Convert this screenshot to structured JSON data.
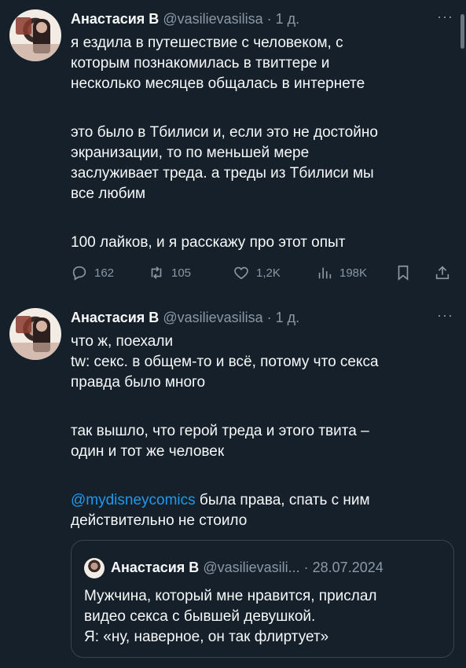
{
  "tweets": [
    {
      "name": "Анастасия В",
      "handle": "@vasilievasilisa",
      "time": "· 1 д.",
      "more": "···",
      "lines": [
        "я ездила в путешествие с человеком, с",
        "которым познакомилась в твиттере и",
        "несколько месяцев общалась в интернете",
        "",
        "это было в Тбилиси и, если это не достойно",
        "экранизации, то по меньшей мере",
        "заслуживает треда. а треды из Тбилиси мы",
        "все любим",
        "",
        "100 лайков, и я расскажу про этот опыт"
      ],
      "actions": {
        "replies": "162",
        "reposts": "105",
        "likes": "1,2K",
        "views": "198K"
      },
      "icons": [
        "reply-icon",
        "repost-icon",
        "like-icon",
        "views-icon",
        "bookmark-icon",
        "share-icon"
      ]
    },
    {
      "name": "Анастасия В",
      "handle": "@vasilievasilisa",
      "time": "· 1 д.",
      "more": "···",
      "lines": [
        "что ж, поехали",
        "tw: секс. в общем-то и всё, потому что секса",
        "правда было много",
        "",
        "так вышло, что герой треда и этого твита –",
        "один и тот же человек",
        ""
      ],
      "mention": "@mydisneycomics",
      "mention_rest": " была права, спать с ним",
      "last_line": "действительно не стоило",
      "quote": {
        "name": "Анастасия В",
        "handle": "@vasilievasili...",
        "date": "· 28.07.2024",
        "lines": [
          "Мужчина, который мне нравится, прислал",
          "видео секса с бывшей девушкой.",
          "Я: «ну, наверное, он так флиртует»"
        ]
      }
    }
  ],
  "colors": {
    "background": "#15202b",
    "text": "#f7f9f9",
    "muted": "#8b98a5",
    "link": "#1d9bf0",
    "border": "#38444d"
  }
}
